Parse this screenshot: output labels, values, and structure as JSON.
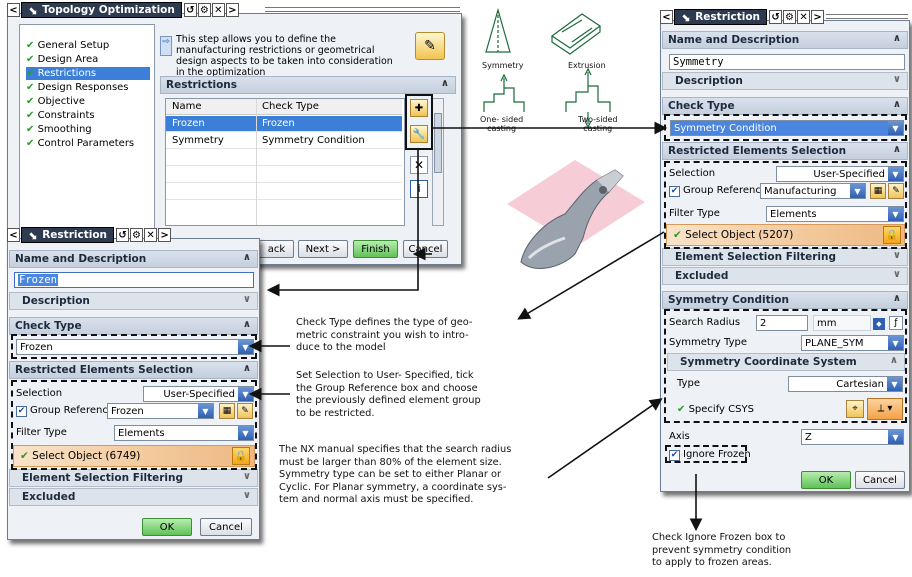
{
  "topo": {
    "title": "Topology Optimization",
    "tree": [
      "General Setup",
      "Design Area",
      "Restrictions",
      "Design Responses",
      "Objective",
      "Constraints",
      "Smoothing",
      "Control Parameters"
    ],
    "info": "This step allows you to define the manufacturing restrictions or geometrical design aspects to be taken into consideration in the optimization",
    "section": "Restrictions",
    "table_headers": [
      "Name",
      "Check Type"
    ],
    "rows": [
      {
        "name": "Frozen",
        "type": "Frozen"
      },
      {
        "name": "Symmetry",
        "type": "Symmetry Condition"
      }
    ],
    "buttons": {
      "back": "ack",
      "next": "Next >",
      "finish": "Finish",
      "cancel": "Cancel"
    }
  },
  "frozen_dlg": {
    "title": "Restriction",
    "name_desc": "Name and Description",
    "name_value": "Frozen",
    "description": "Description",
    "check_type": "Check Type",
    "check_value": "Frozen",
    "restricted": "Restricted Elements Selection",
    "selection_label": "Selection",
    "selection_value": "User-Specified",
    "group_ref_label": "Group Reference",
    "group_ref_value": "Frozen",
    "filter_label": "Filter Type",
    "filter_value": "Elements",
    "select_object": "Select Object (6749)",
    "filtering": "Element Selection Filtering",
    "excluded": "Excluded",
    "ok": "OK",
    "cancel": "Cancel"
  },
  "sym_dlg": {
    "title": "Restriction",
    "name_desc": "Name and Description",
    "name_value": "Symmetry",
    "description": "Description",
    "check_type": "Check Type",
    "check_value": "Symmetry Condition",
    "restricted": "Restricted Elements Selection",
    "selection_label": "Selection",
    "selection_value": "User-Specified",
    "group_ref_label": "Group Reference",
    "group_ref_value": "Manufacturing",
    "filter_label": "Filter Type",
    "filter_value": "Elements",
    "select_object": "Select Object (5207)",
    "filtering": "Element Selection Filtering",
    "excluded": "Excluded",
    "sym_condition": "Symmetry Condition",
    "search_radius_label": "Search Radius",
    "search_radius_value": "2",
    "search_radius_unit": "mm",
    "sym_type_label": "Symmetry Type",
    "sym_type_value": "PLANE_SYM",
    "csys_head": "Symmetry Coordinate System",
    "type_label": "Type",
    "type_value": "Cartesian",
    "specify_csys": "Specify CSYS",
    "axis_label": "Axis",
    "axis_value": "Z",
    "ignore_frozen": "Ignore Frozen",
    "ok": "OK",
    "cancel": "Cancel"
  },
  "captions": {
    "symmetry": "Symmetry",
    "extrusion": "Extrusion",
    "one_sided": "One- sided\ncasting",
    "two_sided": "Two-sided\ncasting"
  },
  "notes": {
    "check_type": "Check Type defines the type of geo-\nmetric constraint you wish to intro-\nduce to the model",
    "selection": "Set Selection to User- Specified, tick\nthe Group Reference box and choose\nthe previously defined element group\nto be restricted.",
    "nx_manual": "The NX manual specifies that the search radius\nmust be larger than 80% of the element size.\nSymmetry type can be set to either Planar or\nCyclic. For Planar symmetry, a coordinate sys-\ntem and normal axis must be specified.",
    "ignore_frozen": "Check Ignore Frozen box to\nprevent symmetry condition\nto apply to frozen areas."
  }
}
